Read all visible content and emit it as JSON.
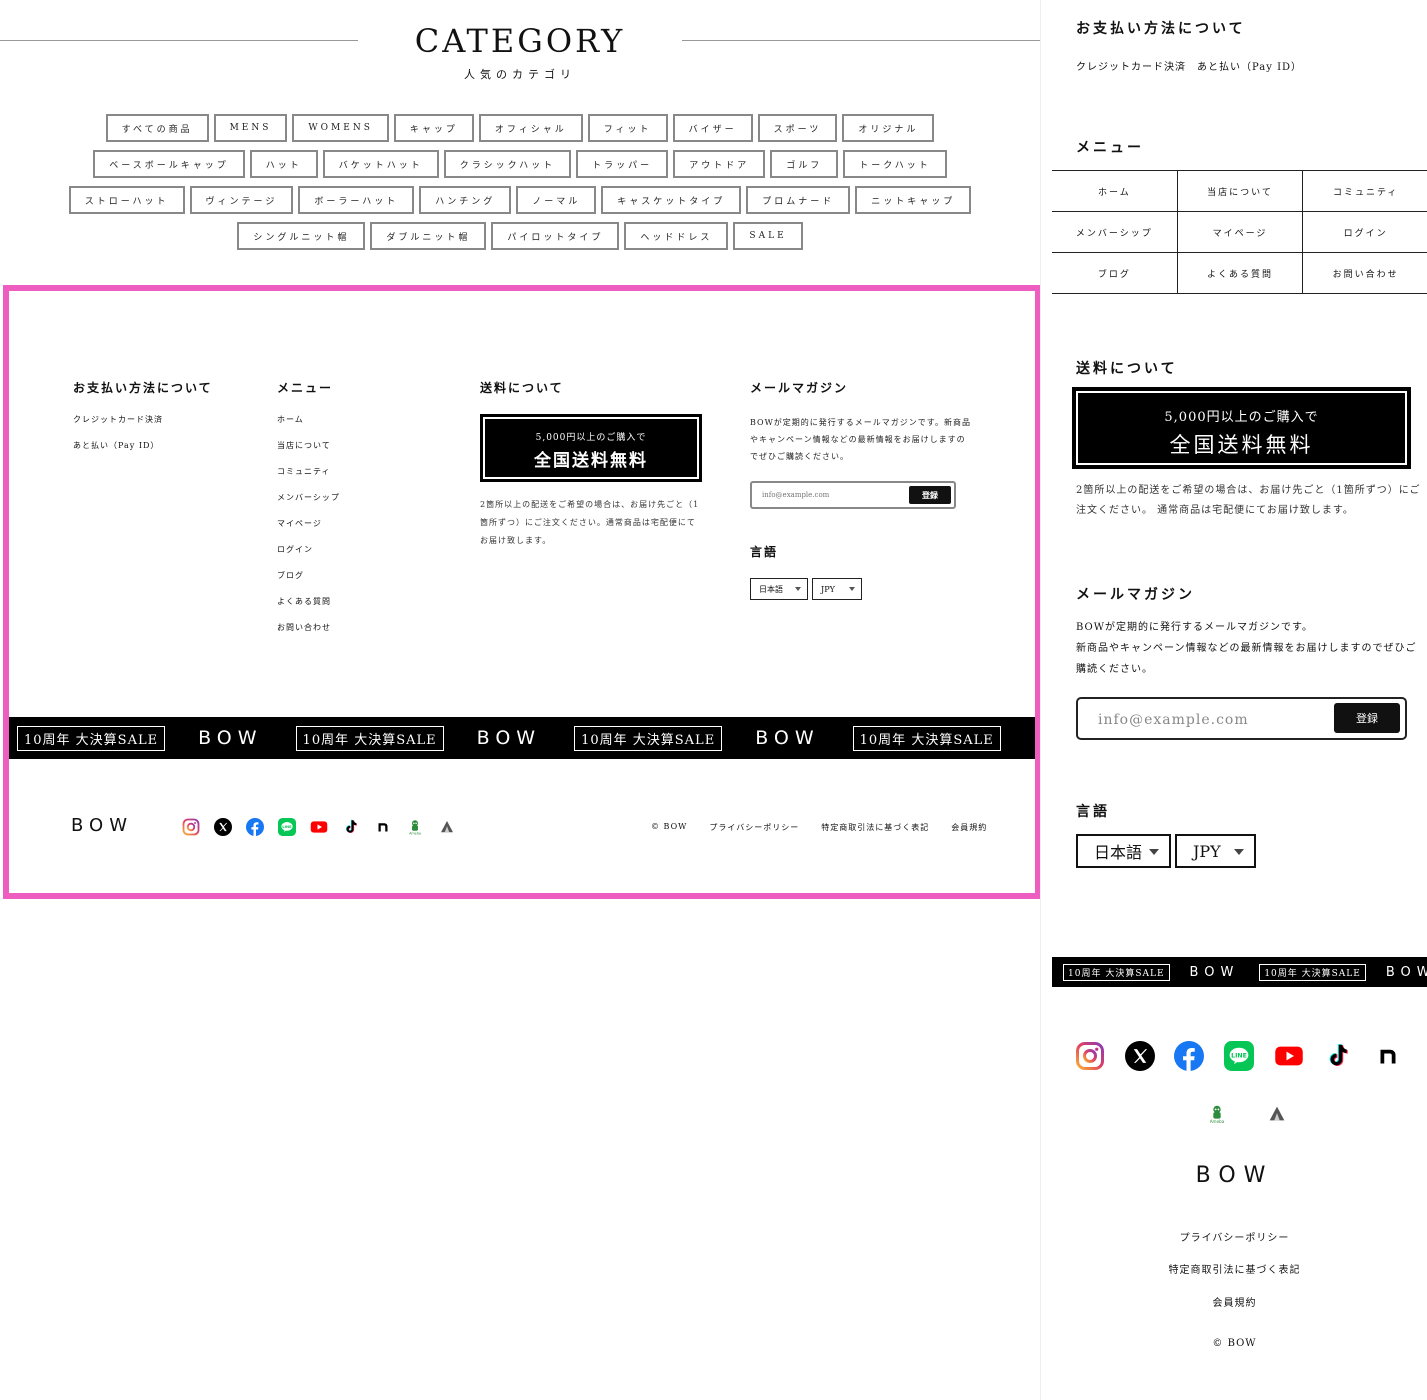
{
  "category": {
    "title": "CATEGORY",
    "subtitle": "人気のカテゴリ",
    "rows": [
      [
        "すべての商品",
        "MENS",
        "WOMENS",
        "キャップ",
        "オフィシャル",
        "フィット",
        "バイザー",
        "スポーツ",
        "オリジナル"
      ],
      [
        "ベースボールキャップ",
        "ハット",
        "バケットハット",
        "クラシックハット",
        "トラッパー",
        "アウトドア",
        "ゴルフ",
        "トークハット"
      ],
      [
        "ストローハット",
        "ヴィンテージ",
        "ボーラーハット",
        "ハンチング",
        "ノーマル",
        "キャスケットタイプ",
        "プロムナード",
        "ニットキャップ"
      ],
      [
        "シングルニット帽",
        "ダブルニット帽",
        "パイロットタイプ",
        "ヘッドドレス",
        "SALE"
      ]
    ]
  },
  "footer": {
    "payment": {
      "heading": "お支払い方法について",
      "items": [
        "クレジットカード決済",
        "あと払い（Pay ID）"
      ]
    },
    "menu": {
      "heading": "メニュー",
      "items": [
        "ホーム",
        "当店について",
        "コミュニティ",
        "メンバーシップ",
        "マイページ",
        "ログイン",
        "ブログ",
        "よくある質問",
        "お問い合わせ"
      ]
    },
    "shipping": {
      "heading": "送料について",
      "box_small": "5,000円以上のご購入で",
      "box_big": "全国送料無料",
      "note": "2箇所以上の配送をご希望の場合は、お届け先ごと（1箇所ずつ）にご注文ください。通常商品は宅配便にてお届け致します。"
    },
    "newsletter": {
      "heading": "メールマガジン",
      "text": "BOWが定期的に発行するメールマガジンです。新商品やキャンペーン情報などの最新情報をお届けしますのでぜひご購読ください。",
      "placeholder": "info@example.com",
      "button": "登録"
    },
    "language": {
      "heading": "言語",
      "lang": "日本語",
      "currency": "JPY"
    },
    "band": {
      "sale": "10周年 大決算SALE",
      "brand": "BOW"
    },
    "logo": "BOW",
    "copyright": "© BOW",
    "legal": [
      "プライバシーポリシー",
      "特定商取引法に基づく表記",
      "会員規約"
    ]
  },
  "mobile": {
    "payment_items": "クレジットカード決済　あと払い（Pay ID）",
    "newsletter_lines": [
      "BOWが定期的に発行するメールマガジンです。",
      "新商品やキャンペーン情報などの最新情報をお届けしますのでぜひご",
      "購読ください。"
    ],
    "shipping_lines": [
      "2箇所以上の配送をご希望の場合は、お届け先ごと（1箇所ずつ）にご",
      "注文ください。 通常商品は宅配便にてお届け致します。"
    ]
  },
  "social_icons": [
    "instagram-icon",
    "x-icon",
    "facebook-icon",
    "line-icon",
    "youtube-icon",
    "tiktok-icon",
    "note-icon",
    "ameba-icon",
    "tent-icon"
  ],
  "colors": {
    "frame": "#ee5ec0",
    "band": "#000000"
  }
}
